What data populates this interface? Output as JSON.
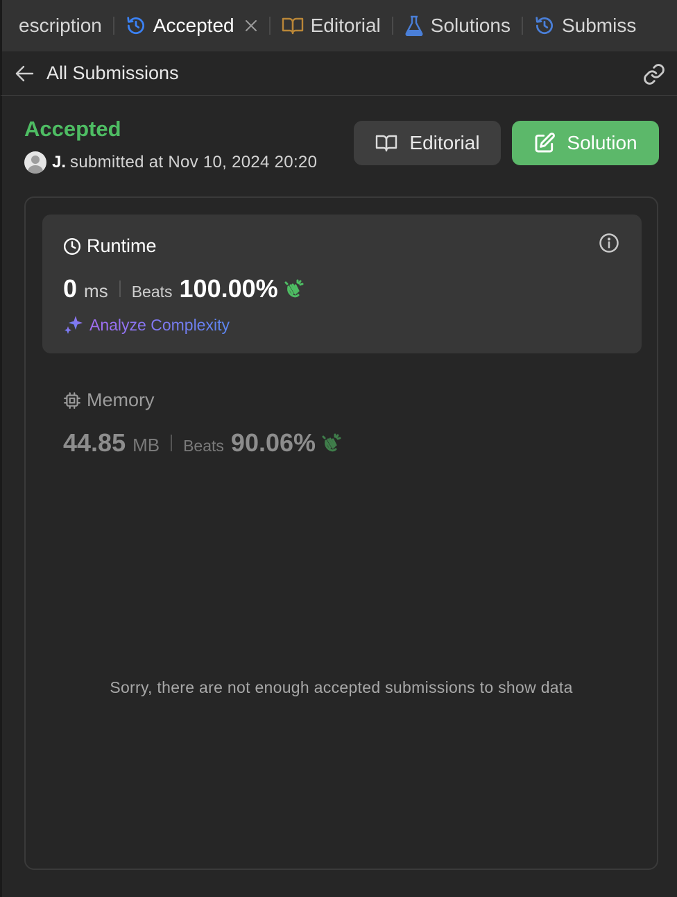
{
  "tabs": {
    "description_label": "escription",
    "accepted_label": "Accepted",
    "editorial_label": "Editorial",
    "solutions_label": "Solutions",
    "submissions_label": "Submiss"
  },
  "subheader": {
    "title": "All Submissions"
  },
  "submission": {
    "status": "Accepted",
    "user_name": "J.",
    "submitted_text": "submitted at Nov 10, 2024 20:20"
  },
  "actions": {
    "editorial_label": "Editorial",
    "solution_label": "Solution"
  },
  "runtime": {
    "title": "Runtime",
    "value": "0",
    "unit": "ms",
    "beats_label": "Beats",
    "beats_value": "100.00%",
    "analyze_label": "Analyze Complexity"
  },
  "memory": {
    "title": "Memory",
    "value": "44.85",
    "unit": "MB",
    "beats_label": "Beats",
    "beats_value": "90.06%"
  },
  "chart_message": "Sorry, there are not enough accepted submissions to show data",
  "colors": {
    "accent_green": "#4ebd63",
    "solution_button": "#5cb86a",
    "blue_icon": "#3b82f6",
    "editorial_icon": "#b98638"
  }
}
